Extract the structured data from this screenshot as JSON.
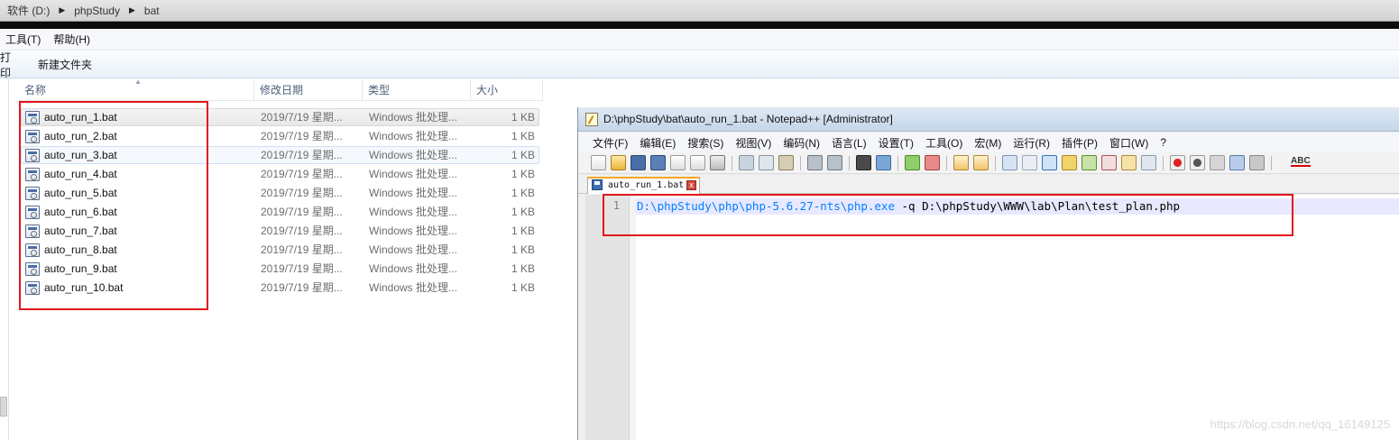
{
  "explorer": {
    "breadcrumb": [
      "软件 (D:)",
      "phpStudy",
      "bat"
    ],
    "menu": [
      "工具(T)",
      "帮助(H)"
    ],
    "commands": [
      "打印",
      "新建文件夹"
    ],
    "columns": [
      "名称",
      "修改日期",
      "类型",
      "大小"
    ],
    "files": [
      {
        "name": "auto_run_1.bat",
        "date": "2019/7/19 星期...",
        "type": "Windows 批处理...",
        "size": "1 KB"
      },
      {
        "name": "auto_run_2.bat",
        "date": "2019/7/19 星期...",
        "type": "Windows 批处理...",
        "size": "1 KB"
      },
      {
        "name": "auto_run_3.bat",
        "date": "2019/7/19 星期...",
        "type": "Windows 批处理...",
        "size": "1 KB"
      },
      {
        "name": "auto_run_4.bat",
        "date": "2019/7/19 星期...",
        "type": "Windows 批处理...",
        "size": "1 KB"
      },
      {
        "name": "auto_run_5.bat",
        "date": "2019/7/19 星期...",
        "type": "Windows 批处理...",
        "size": "1 KB"
      },
      {
        "name": "auto_run_6.bat",
        "date": "2019/7/19 星期...",
        "type": "Windows 批处理...",
        "size": "1 KB"
      },
      {
        "name": "auto_run_7.bat",
        "date": "2019/7/19 星期...",
        "type": "Windows 批处理...",
        "size": "1 KB"
      },
      {
        "name": "auto_run_8.bat",
        "date": "2019/7/19 星期...",
        "type": "Windows 批处理...",
        "size": "1 KB"
      },
      {
        "name": "auto_run_9.bat",
        "date": "2019/7/19 星期...",
        "type": "Windows 批处理...",
        "size": "1 KB"
      },
      {
        "name": "auto_run_10.bat",
        "date": "2019/7/19 星期...",
        "type": "Windows 批处理...",
        "size": "1 KB"
      }
    ]
  },
  "notepad": {
    "title": "D:\\phpStudy\\bat\\auto_run_1.bat - Notepad++ [Administrator]",
    "menu": [
      "文件(F)",
      "编辑(E)",
      "搜索(S)",
      "视图(V)",
      "编码(N)",
      "语言(L)",
      "设置(T)",
      "工具(O)",
      "宏(M)",
      "运行(R)",
      "插件(P)",
      "窗口(W)",
      "?"
    ],
    "toolbar_spellcheck": "ABC",
    "tab_label": "auto_run_1.bat",
    "tab_close": "x",
    "line_number": "1",
    "code_path": "D:\\phpStudy\\php\\php-5.6.27-nts\\php.exe",
    "code_args": " -q D:\\phpStudy\\WWW\\lab\\Plan\\test_plan.php"
  },
  "watermark": "https://blog.csdn.net/qq_16149125",
  "colors": {
    "highlight_red": "#e0171c",
    "code_path": "#0080ff",
    "tab_accent": "#f5a623"
  }
}
